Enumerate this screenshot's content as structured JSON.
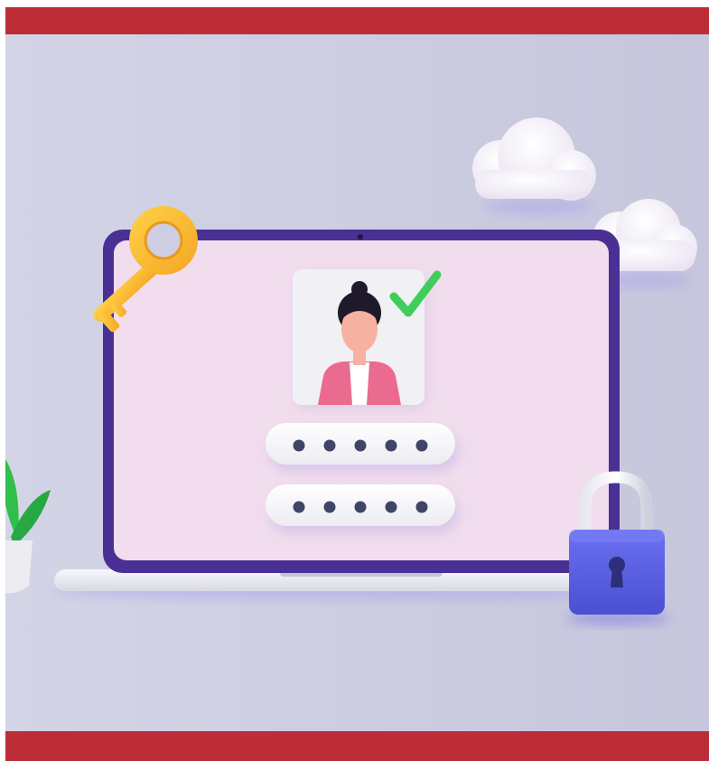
{
  "colors": {
    "frame_red": "#bd2d37",
    "background": "#c9cadf",
    "laptop_bezel": "#4a2f94",
    "laptop_screen": "#f1dded",
    "key": "#f7b731",
    "padlock_body": "#5b61e0",
    "check": "#3fce5c",
    "jacket": "#ea6b8f",
    "plant": "#2fbf4a"
  },
  "icons": {
    "key": "key-icon",
    "padlock": "padlock-icon",
    "checkmark": "checkmark-icon",
    "user": "user-avatar-icon",
    "cloud": "cloud-icon",
    "plant": "plant-icon"
  },
  "password_fields": [
    {
      "masked_dots": 5
    },
    {
      "masked_dots": 5
    }
  ]
}
